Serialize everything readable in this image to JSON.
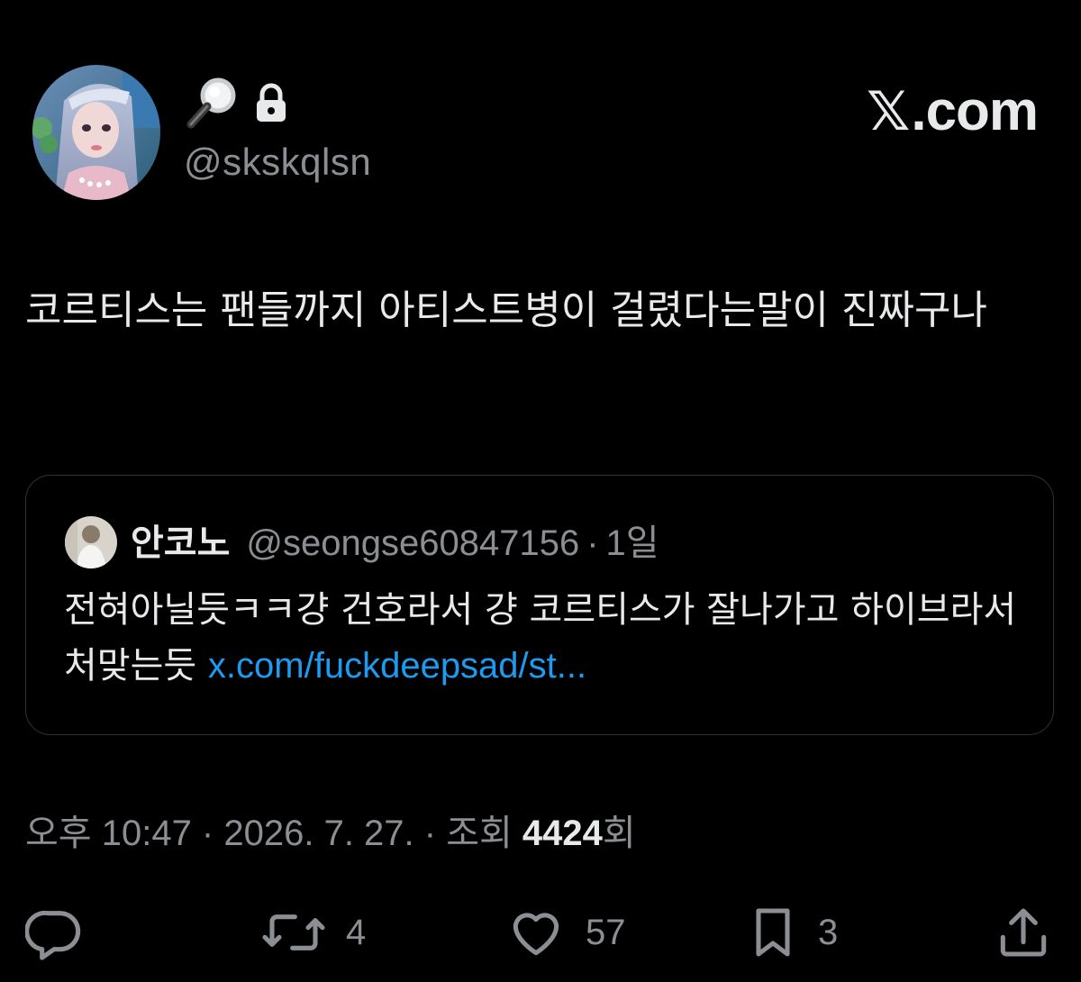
{
  "author": {
    "display_name": "🔍🔒",
    "handle": "@skskqlsn"
  },
  "brand": {
    "x_glyph": "𝕏",
    "suffix": ".com"
  },
  "tweet": {
    "text": "코르티스는 팬들까지 아티스트병이 걸렸다는말이 진짜구나"
  },
  "quote": {
    "name": "안코노",
    "handle": "@seongse60847156",
    "separator": "·",
    "time": "1일",
    "text": "전혀아닐듯ㅋㅋ걍 건호라서 걍 코르티스가 잘나가고 하이브라서 처맞는듯 ",
    "link": "x.com/fuckdeepsad/st..."
  },
  "meta": {
    "time": "오후 10:47",
    "separator": " · ",
    "date": "2026. 7. 27.",
    "views_prefix": "조회 ",
    "views_count": "4424",
    "views_suffix": "회"
  },
  "actions": {
    "reply_icon": "reply-icon",
    "retweet_icon": "retweet-icon",
    "retweet_count": "4",
    "like_icon": "heart-icon",
    "like_count": "57",
    "bookmark_icon": "bookmark-icon",
    "bookmark_count": "3",
    "share_icon": "share-icon"
  },
  "colors": {
    "background": "#000000",
    "text_primary": "#e7e9ea",
    "text_secondary": "#8b8f94",
    "link": "#1d9bf0",
    "border": "#2f3336"
  }
}
